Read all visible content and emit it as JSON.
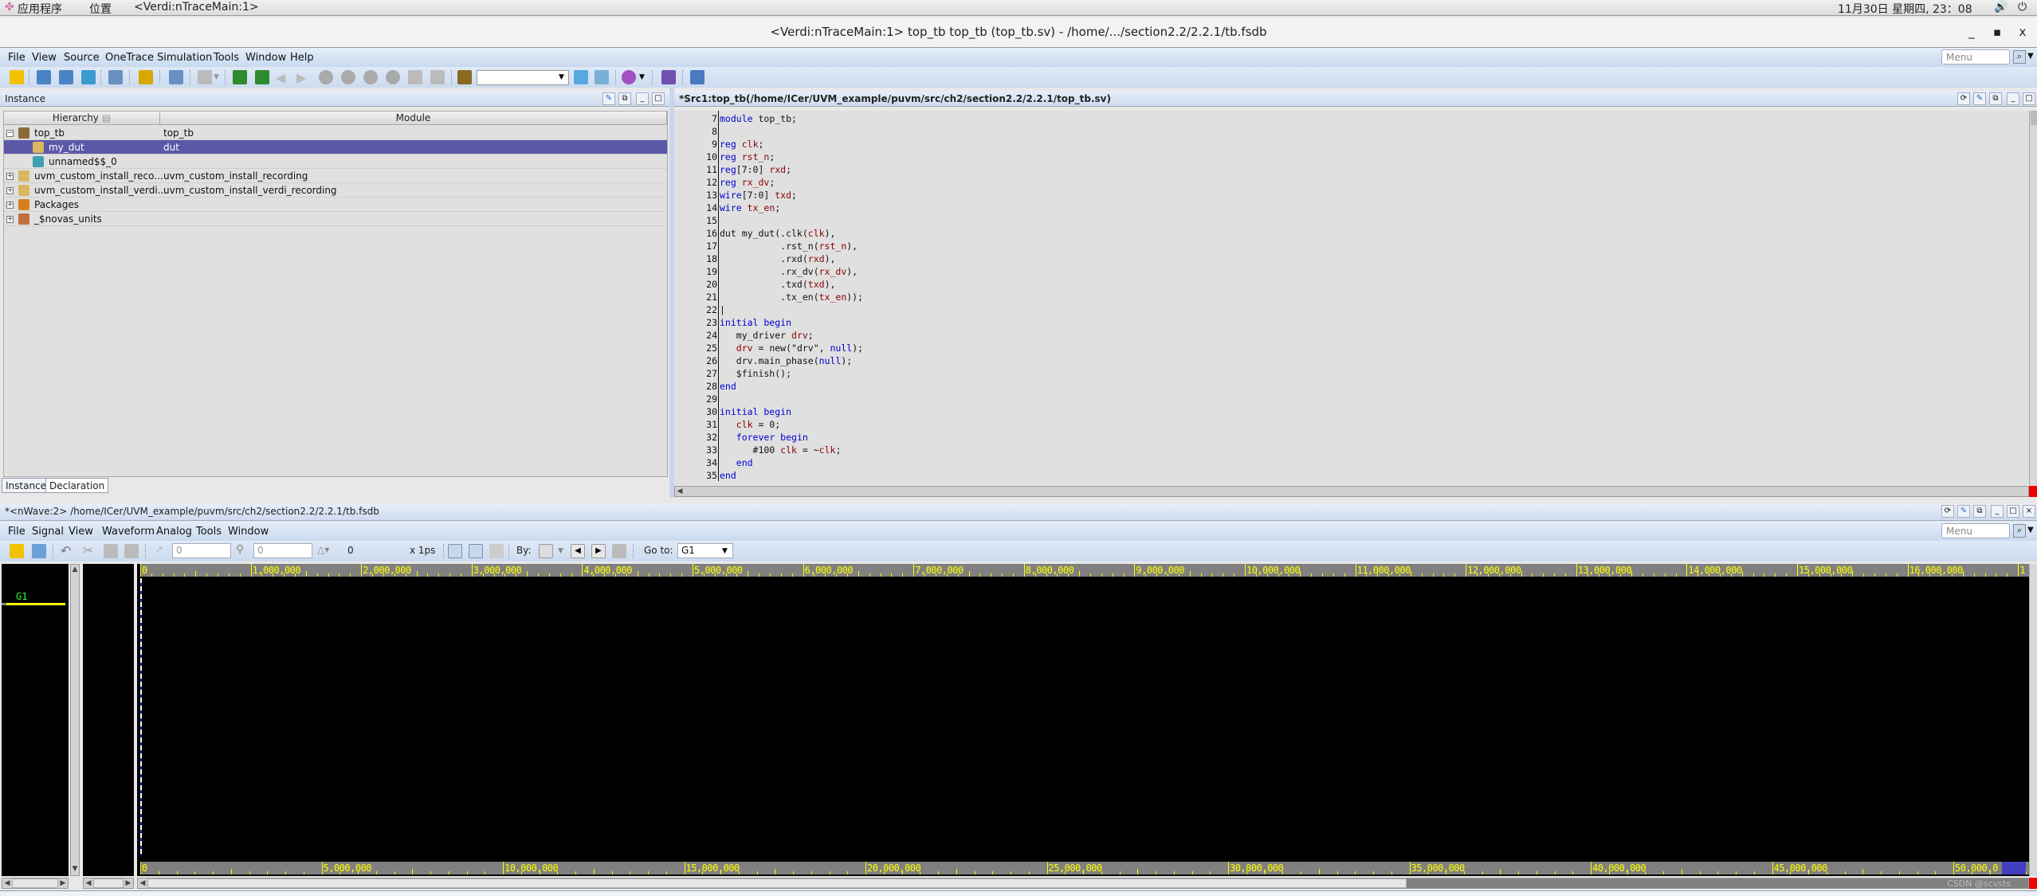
{
  "system_bar": {
    "apps_label": "应用程序",
    "places_label": "位置",
    "active_window": "<Verdi:nTraceMain:1>",
    "datetime": "11月30日 星期四, 23：08"
  },
  "window": {
    "title": "<Verdi:nTraceMain:1> top_tb top_tb (top_tb.sv) - /home/.../section2.2/2.2.1/tb.fsdb",
    "minimize": "_",
    "maximize": "▫",
    "close": "x"
  },
  "main_menu": {
    "items": [
      "File",
      "View",
      "Source",
      "OneTrace",
      "Simulation",
      "Tools",
      "Window",
      "Help"
    ],
    "menu_search_placeholder": "Menu"
  },
  "main_toolbar": {
    "search_combo_value": ""
  },
  "instance_panel": {
    "title": "Instance",
    "columns": [
      "Hierarchy",
      "Module"
    ],
    "rows": [
      {
        "hierarchy": "top_tb",
        "module": "top_tb",
        "level": 0,
        "expander": "−",
        "selected": false
      },
      {
        "hierarchy": "my_dut",
        "module": "dut",
        "level": 1,
        "expander": "",
        "selected": true
      },
      {
        "hierarchy": "unnamed$$_0",
        "module": "",
        "level": 1,
        "expander": "",
        "selected": false
      },
      {
        "hierarchy": "uvm_custom_install_reco...",
        "module": "uvm_custom_install_recording",
        "level": 0,
        "expander": "+",
        "selected": false
      },
      {
        "hierarchy": "uvm_custom_install_verdi...",
        "module": "uvm_custom_install_verdi_recording",
        "level": 0,
        "expander": "+",
        "selected": false
      },
      {
        "hierarchy": "Packages",
        "module": "",
        "level": 0,
        "expander": "+",
        "selected": false
      },
      {
        "hierarchy": "_$novas_units",
        "module": "",
        "level": 0,
        "expander": "+",
        "selected": false
      }
    ],
    "tabs": [
      "Instance",
      "Declaration"
    ]
  },
  "source_panel": {
    "title": "*Src1:top_tb(/home/ICer/UVM_example/puvm/src/ch2/section2.2/2.2.1/top_tb.sv)",
    "lines": [
      {
        "n": "7",
        "tokens": [
          [
            "kw",
            "module"
          ],
          [
            "pl",
            " top_tb;"
          ]
        ]
      },
      {
        "n": "8",
        "tokens": []
      },
      {
        "n": "9",
        "tokens": [
          [
            "kw",
            "reg"
          ],
          [
            "pl",
            " "
          ],
          [
            "id",
            "clk"
          ],
          [
            "pl",
            ";"
          ]
        ]
      },
      {
        "n": "10",
        "tokens": [
          [
            "kw",
            "reg"
          ],
          [
            "pl",
            " "
          ],
          [
            "id",
            "rst_n"
          ],
          [
            "pl",
            ";"
          ]
        ]
      },
      {
        "n": "11",
        "tokens": [
          [
            "kw",
            "reg"
          ],
          [
            "pl",
            "[7:0] "
          ],
          [
            "id",
            "rxd"
          ],
          [
            "pl",
            ";"
          ]
        ]
      },
      {
        "n": "12",
        "tokens": [
          [
            "kw",
            "reg"
          ],
          [
            "pl",
            " "
          ],
          [
            "id",
            "rx_dv"
          ],
          [
            "pl",
            ";"
          ]
        ]
      },
      {
        "n": "13",
        "tokens": [
          [
            "kw",
            "wire"
          ],
          [
            "pl",
            "[7:0] "
          ],
          [
            "id",
            "txd"
          ],
          [
            "pl",
            ";"
          ]
        ]
      },
      {
        "n": "14",
        "tokens": [
          [
            "kw",
            "wire"
          ],
          [
            "pl",
            " "
          ],
          [
            "id",
            "tx_en"
          ],
          [
            "pl",
            ";"
          ]
        ]
      },
      {
        "n": "15",
        "tokens": []
      },
      {
        "n": "16",
        "tokens": [
          [
            "pl",
            "dut my_dut(.clk("
          ],
          [
            "id",
            "clk"
          ],
          [
            "pl",
            "),"
          ]
        ]
      },
      {
        "n": "17",
        "tokens": [
          [
            "pl",
            "           .rst_n("
          ],
          [
            "id",
            "rst_n"
          ],
          [
            "pl",
            "),"
          ]
        ]
      },
      {
        "n": "18",
        "tokens": [
          [
            "pl",
            "           .rxd("
          ],
          [
            "id",
            "rxd"
          ],
          [
            "pl",
            "),"
          ]
        ]
      },
      {
        "n": "19",
        "tokens": [
          [
            "pl",
            "           .rx_dv("
          ],
          [
            "id",
            "rx_dv"
          ],
          [
            "pl",
            "),"
          ]
        ]
      },
      {
        "n": "20",
        "tokens": [
          [
            "pl",
            "           .txd("
          ],
          [
            "id",
            "txd"
          ],
          [
            "pl",
            "),"
          ]
        ]
      },
      {
        "n": "21",
        "tokens": [
          [
            "pl",
            "           .tx_en("
          ],
          [
            "id",
            "tx_en"
          ],
          [
            "pl",
            "));"
          ]
        ]
      },
      {
        "n": "22",
        "tokens": [
          [
            "pl",
            "|"
          ]
        ]
      },
      {
        "n": "23",
        "tokens": [
          [
            "kw",
            "initial begin"
          ]
        ]
      },
      {
        "n": "24",
        "tokens": [
          [
            "pl",
            "   my_driver "
          ],
          [
            "id",
            "drv"
          ],
          [
            "pl",
            ";"
          ]
        ]
      },
      {
        "n": "25",
        "tokens": [
          [
            "pl",
            "   "
          ],
          [
            "id",
            "drv"
          ],
          [
            "pl",
            " = new(\"drv\", "
          ],
          [
            "kw",
            "null"
          ],
          [
            "pl",
            ");"
          ]
        ]
      },
      {
        "n": "26",
        "tokens": [
          [
            "pl",
            "   drv.main_phase("
          ],
          [
            "kw",
            "null"
          ],
          [
            "pl",
            ");"
          ]
        ]
      },
      {
        "n": "27",
        "tokens": [
          [
            "pl",
            "   $finish();"
          ]
        ]
      },
      {
        "n": "28",
        "tokens": [
          [
            "kw",
            "end"
          ]
        ]
      },
      {
        "n": "29",
        "tokens": []
      },
      {
        "n": "30",
        "tokens": [
          [
            "kw",
            "initial begin"
          ]
        ]
      },
      {
        "n": "31",
        "tokens": [
          [
            "pl",
            "   "
          ],
          [
            "id",
            "clk"
          ],
          [
            "pl",
            " = 0;"
          ]
        ]
      },
      {
        "n": "32",
        "tokens": [
          [
            "pl",
            "   "
          ],
          [
            "kw",
            "forever begin"
          ]
        ]
      },
      {
        "n": "33",
        "tokens": [
          [
            "pl",
            "      #100 "
          ],
          [
            "id",
            "clk"
          ],
          [
            "pl",
            " = ~"
          ],
          [
            "id",
            "clk"
          ],
          [
            "pl",
            ";"
          ]
        ]
      },
      {
        "n": "34",
        "tokens": [
          [
            "pl",
            "   "
          ],
          [
            "kw",
            "end"
          ]
        ]
      },
      {
        "n": "35",
        "tokens": [
          [
            "kw",
            "end"
          ]
        ]
      }
    ]
  },
  "nwave": {
    "title": "*<nWave:2> /home/ICer/UVM_example/puvm/src/ch2/section2.2/2.2.1/tb.fsdb",
    "menu": [
      "File",
      "Signal",
      "View",
      "Waveform",
      "Analog",
      "Tools",
      "Window"
    ],
    "menu_search_placeholder": "Menu",
    "cursor_time": "0",
    "marker_time": "0",
    "delta": "0",
    "time_unit": "x 1ps",
    "by_label": "By:",
    "goto_label": "Go to:",
    "goto_value": "G1",
    "group_name": "G1",
    "top_ruler": [
      "0",
      "1,000,000",
      "2,000,000",
      "3,000,000",
      "4,000,000",
      "5,000,000",
      "6,000,000",
      "7,000,000",
      "8,000,000",
      "9,000,000",
      "10,000,000",
      "11,000,000",
      "12,000,000",
      "13,000,000",
      "14,000,000",
      "15,000,000",
      "16,000,000",
      "1"
    ],
    "bottom_ruler": [
      "0",
      "5,000,000",
      "10,000,000",
      "15,000,000",
      "20,000,000",
      "25,000,000",
      "30,000,000",
      "35,000,000",
      "40,000,000",
      "45,000,000",
      "50,000,0"
    ],
    "watermark": "CSDN @scvsts"
  },
  "colors": {
    "selection": "#5b58a8",
    "keyword": "#0000d0",
    "identifier": "#8b0000",
    "ruler_text": "#ffff00",
    "group_text": "#33ff33"
  }
}
